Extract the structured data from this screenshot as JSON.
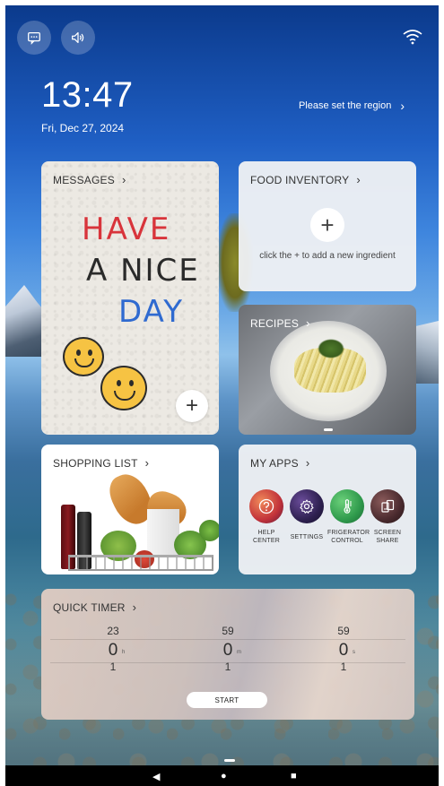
{
  "status": {
    "time": "13:47",
    "date": "Fri, Dec 27, 2024",
    "region_prompt": "Please set the region",
    "chevron": "›"
  },
  "cards": {
    "messages": {
      "title": "MESSAGES",
      "note_line1": "HAVE",
      "note_line2": "A NICE",
      "note_line3": "DAY",
      "add": "+"
    },
    "food_inventory": {
      "title": "FOOD INVENTORY",
      "add": "+",
      "hint": "click the + to add a new ingredient"
    },
    "recipes": {
      "title": "RECIPES"
    },
    "shopping_list": {
      "title": "SHOPPING LIST"
    },
    "my_apps": {
      "title": "MY APPS",
      "apps": [
        {
          "label": "HELP CENTER",
          "icon": "question-icon",
          "color": "#d4483a"
        },
        {
          "label": "SETTINGS",
          "icon": "gear-icon",
          "color": "#3a2c5e"
        },
        {
          "label": "FRIGERATOR CONTROL",
          "icon": "thermometer-icon",
          "color": "#3fa55a"
        },
        {
          "label": "SCREEN SHARE",
          "icon": "screen-share-icon",
          "color": "#5a3a3a"
        }
      ]
    },
    "quick_timer": {
      "title": "QUICK TIMER",
      "hours": {
        "prev": "23",
        "current": "0",
        "next": "1",
        "unit": "h"
      },
      "minutes": {
        "prev": "59",
        "current": "0",
        "next": "1",
        "unit": "m"
      },
      "seconds": {
        "prev": "59",
        "current": "0",
        "next": "1",
        "unit": "s"
      },
      "start": "START"
    }
  },
  "navbar": {
    "back": "◀",
    "home": "●",
    "recents": "■"
  }
}
